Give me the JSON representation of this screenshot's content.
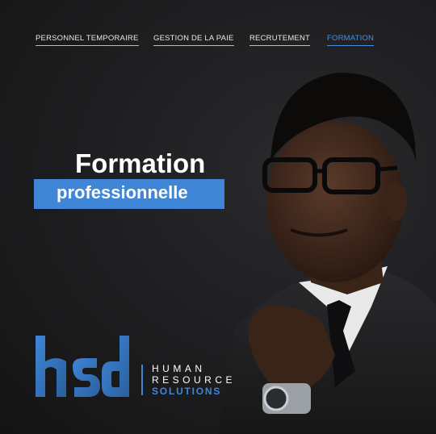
{
  "nav": {
    "items": [
      {
        "label": "PERSONNEL TEMPORAIRE",
        "active": false
      },
      {
        "label": "GESTION DE LA PAIE",
        "active": false
      },
      {
        "label": "RECRUTEMENT",
        "active": false
      },
      {
        "label": "FORMATION",
        "active": true
      }
    ]
  },
  "hero": {
    "title": "Formation",
    "subtitle": "professionnelle"
  },
  "brand": {
    "logo_icon": "hrs-logo-icon",
    "line1": "HUMAN",
    "line2": "RESOURCE",
    "line3": "SOLUTIONS"
  },
  "colors": {
    "accent": "#3f86d6",
    "background": "#1b1b1c",
    "text": "#ffffff"
  }
}
